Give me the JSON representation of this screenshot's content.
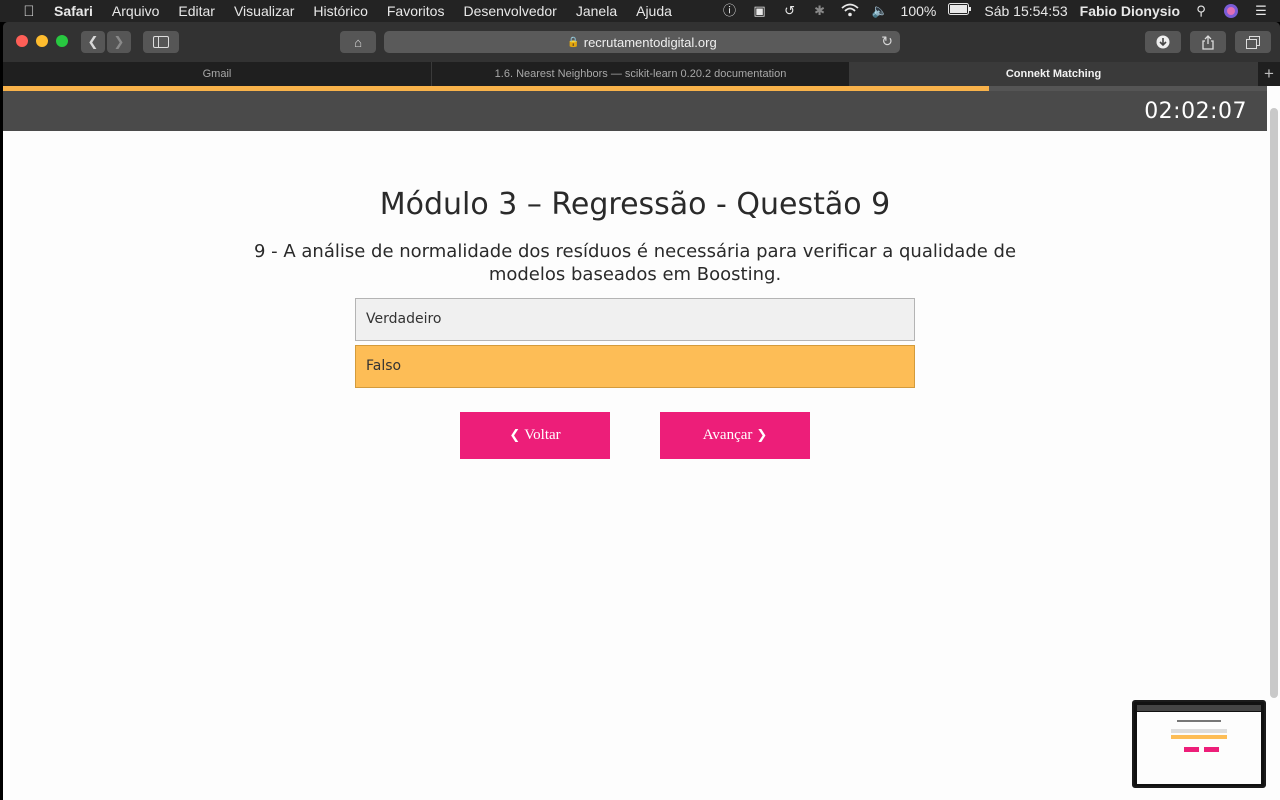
{
  "menubar": {
    "app_name": "Safari",
    "items": [
      "Arquivo",
      "Editar",
      "Visualizar",
      "Histórico",
      "Favoritos",
      "Desenvolvedor",
      "Janela",
      "Ajuda"
    ],
    "battery": "100%",
    "clock": "Sáb 15:54:53",
    "user": "Fabio Dionysio"
  },
  "browser": {
    "url": "recrutamentodigital.org",
    "tabs": [
      {
        "label": "Gmail",
        "active": false
      },
      {
        "label": "1.6. Nearest Neighbors — scikit-learn 0.20.2 documentation",
        "active": false
      },
      {
        "label": "Connekt Matching",
        "active": true
      }
    ]
  },
  "page": {
    "progress": 0.78,
    "timer": "02:02:07",
    "title": "Módulo 3 – Regressão - Questão 9",
    "question": "9 - A análise de normalidade dos resíduos é necessária para verificar a qualidade de modelos baseados em Boosting.",
    "options": [
      {
        "label": "Verdadeiro",
        "selected": false
      },
      {
        "label": "Falso",
        "selected": true
      }
    ],
    "back_label": "Voltar",
    "next_label": "Avançar"
  },
  "colors": {
    "accent": "#ed1e79",
    "selected_option": "#fdbd56",
    "progress": "#f8b24a"
  }
}
